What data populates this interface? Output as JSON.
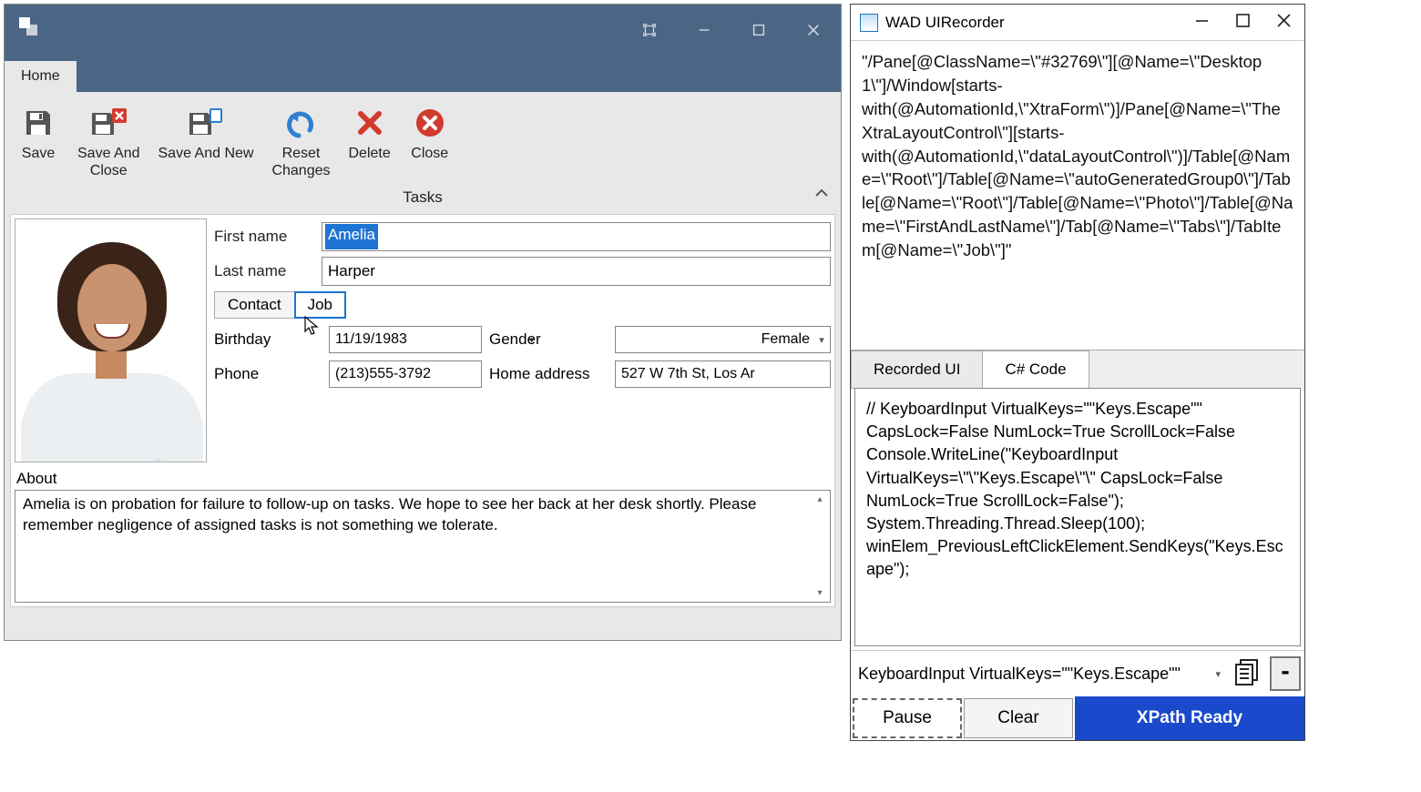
{
  "main": {
    "ribbon_tab": "Home",
    "buttons": {
      "save": "Save",
      "save_close": "Save And\nClose",
      "save_new": "Save And New",
      "reset": "Reset\nChanges",
      "delete": "Delete",
      "close": "Close"
    },
    "tasks_label": "Tasks",
    "form": {
      "first_name_label": "First name",
      "first_name_value": "Amelia",
      "last_name_label": "Last name",
      "last_name_value": "Harper",
      "tab_contact": "Contact",
      "tab_job": "Job",
      "birthday_label": "Birthday",
      "birthday_value": "11/19/1983",
      "gender_label": "Gender",
      "gender_value": "Female",
      "phone_label": "Phone",
      "phone_value": "(213)555-3792",
      "home_addr_label": "Home address",
      "home_addr_value": "527 W 7th St, Los Ar",
      "about_label": "About",
      "about_text": "Amelia is on probation for failure to follow-up on tasks.  We hope to see her back at her desk shortly. Please remember negligence of assigned tasks is not something we tolerate."
    }
  },
  "recorder": {
    "title": "WAD UIRecorder",
    "xpath_text": "\"/Pane[@ClassName=\\\"#32769\\\"][@Name=\\\"Desktop 1\\\"]/Window[starts-with(@AutomationId,\\\"XtraForm\\\")]/Pane[@Name=\\\"The XtraLayoutControl\\\"][starts-with(@AutomationId,\\\"dataLayoutControl\\\")]/Table[@Name=\\\"Root\\\"]/Table[@Name=\\\"autoGeneratedGroup0\\\"]/Table[@Name=\\\"Root\\\"]/Table[@Name=\\\"Photo\\\"]/Table[@Name=\\\"FirstAndLastName\\\"]/Tab[@Name=\\\"Tabs\\\"]/TabItem[@Name=\\\"Job\\\"]\"",
    "tabs": {
      "recorded": "Recorded UI",
      "code": "C# Code"
    },
    "code_text": "// KeyboardInput VirtualKeys=\"\"Keys.Escape\"\" CapsLock=False NumLock=True ScrollLock=False\nConsole.WriteLine(\"KeyboardInput VirtualKeys=\\\"\\\"Keys.Escape\\\"\\\" CapsLock=False NumLock=True ScrollLock=False\");\nSystem.Threading.Thread.Sleep(100);\nwinElem_PreviousLeftClickElement.SendKeys(\"Keys.Escape\");",
    "status_text": "KeyboardInput VirtualKeys=\"\"Keys.Escape\"\"",
    "pause": "Pause",
    "clear": "Clear",
    "ready": "XPath Ready",
    "minus": "-"
  }
}
